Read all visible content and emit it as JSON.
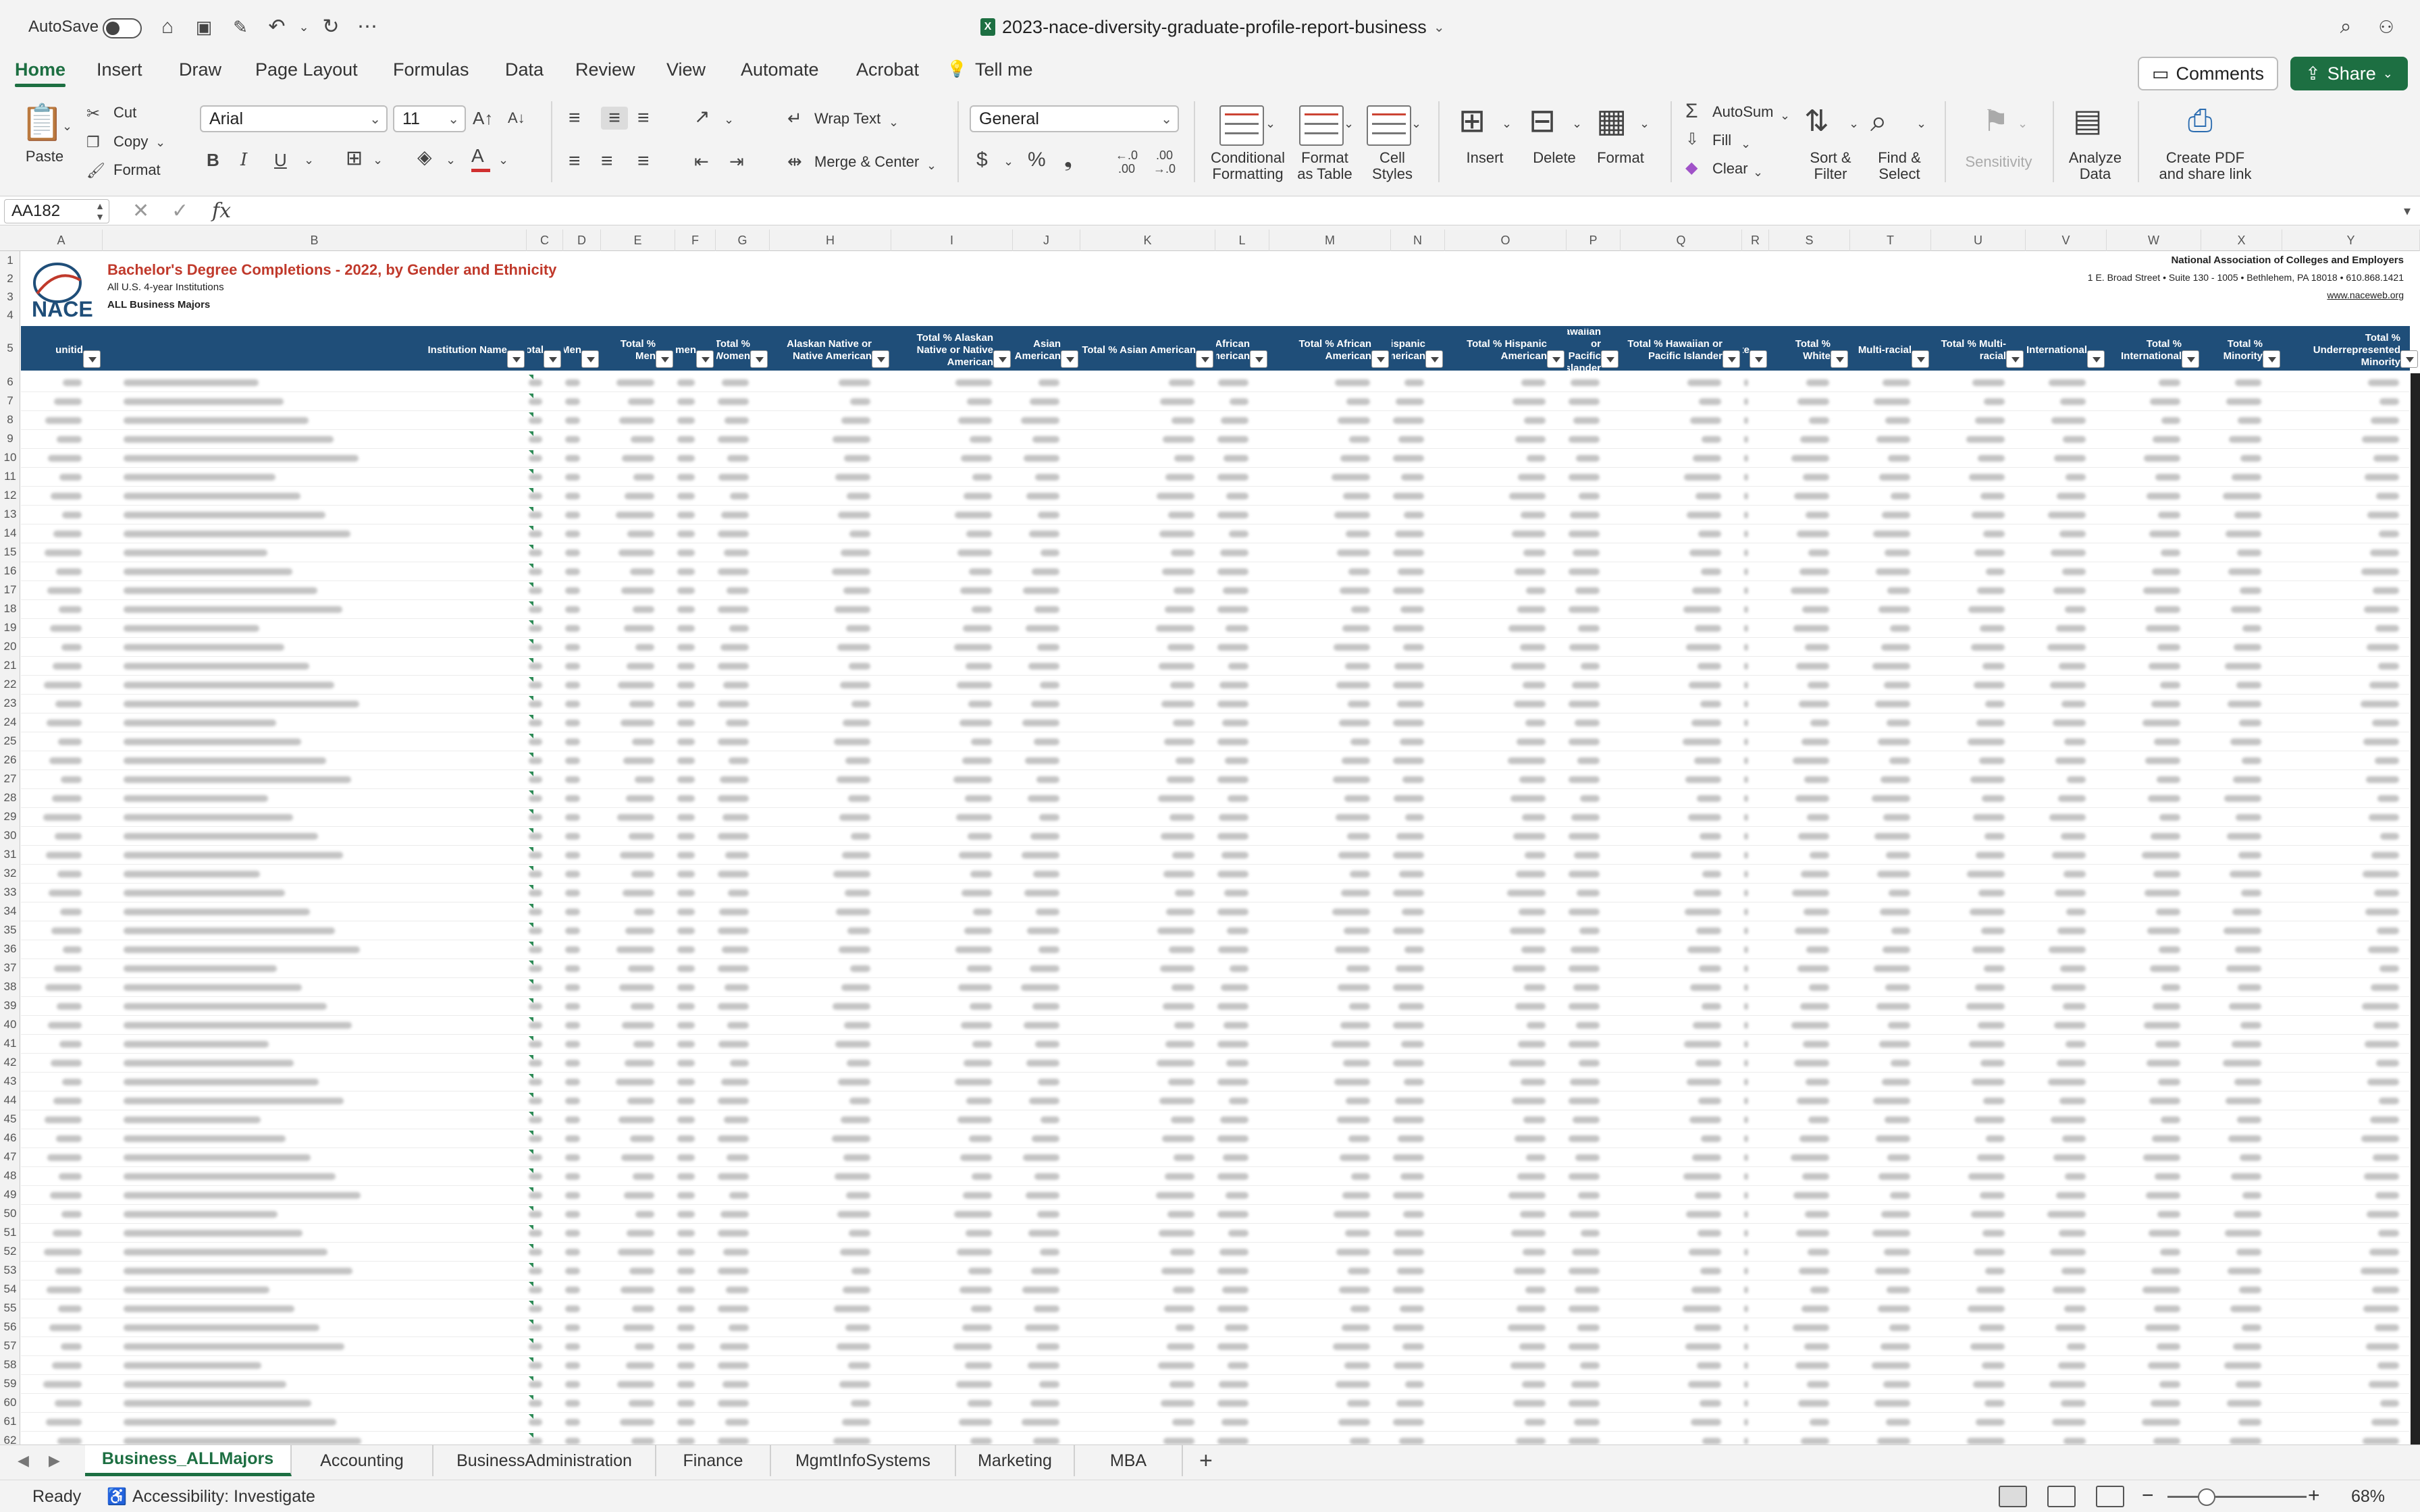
{
  "titlebar": {
    "autosave_label": "AutoSave",
    "document_title": "2023-nace-diversity-graduate-profile-report-business"
  },
  "ribbon_tabs": [
    "Home",
    "Insert",
    "Draw",
    "Page Layout",
    "Formulas",
    "Data",
    "Review",
    "View",
    "Automate",
    "Acrobat",
    "Tell me"
  ],
  "header_buttons": {
    "comments": "Comments",
    "share": "Share"
  },
  "ribbon": {
    "paste": "Paste",
    "cut": "Cut",
    "copy": "Copy",
    "format_painter": "Format",
    "font_name": "Arial",
    "font_size": "11",
    "wrap_text": "Wrap Text",
    "merge_center": "Merge & Center",
    "number_format": "General",
    "conditional_formatting": [
      "Conditional",
      "Formatting"
    ],
    "format_as_table": [
      "Format",
      "as Table"
    ],
    "cell_styles": [
      "Cell",
      "Styles"
    ],
    "insert": "Insert",
    "delete": "Delete",
    "format": "Format",
    "autosum": "AutoSum",
    "fill": "Fill",
    "clear": "Clear",
    "sort_filter": [
      "Sort &",
      "Filter"
    ],
    "find_select": [
      "Find &",
      "Select"
    ],
    "sensitivity": "Sensitivity",
    "analyze_data": [
      "Analyze",
      "Data"
    ],
    "create_pdf": [
      "Create PDF",
      "and share link"
    ]
  },
  "formula_bar": {
    "name_box": "AA182",
    "fx": "fx",
    "formula": ""
  },
  "columns": [
    "A",
    "B",
    "C",
    "D",
    "E",
    "F",
    "G",
    "H",
    "I",
    "J",
    "K",
    "L",
    "M",
    "N",
    "O",
    "P",
    "Q",
    "R",
    "S",
    "T",
    "U",
    "V",
    "W",
    "X",
    "Y"
  ],
  "report": {
    "logo_text": "NACE",
    "title": "Bachelor's Degree Completions - 2022, by Gender and Ethnicity",
    "subtitle": "All U.S. 4-year Institutions",
    "majors": "ALL Business Majors",
    "org_name": "National Association of Colleges and Employers",
    "org_address": "1 E. Broad Street • Suite 130 - 1005 • Bethlehem, PA 18018 • 610.868.1421",
    "org_website": "www.naceweb.org"
  },
  "table_headers": [
    "unitid",
    "Institution Name",
    "Total",
    "Men",
    "Total % Men",
    "Women",
    "Total % Women",
    "Alaskan Native or Native American",
    "Total % Alaskan Native or Native American",
    "Asian American",
    "Total % Asian American",
    "African American",
    "Total % African American",
    "Hispanic American",
    "Total % Hispanic American",
    "Hawaiian or Pacific Islander",
    "Total % Hawaiian or Pacific Islander",
    "White",
    "Total % White",
    "Multi-racial",
    "Total % Multi-racial",
    "International",
    "Total % International",
    "Total % Minority",
    "Total % Underrepresented Minority"
  ],
  "sheet_tabs": [
    "Business_ALLMajors",
    "Accounting",
    "BusinessAdministration",
    "Finance",
    "MgmtInfoSystems",
    "Marketing",
    "MBA"
  ],
  "active_sheet": "Business_ALLMajors",
  "status": {
    "ready": "Ready",
    "accessibility": "Accessibility: Investigate",
    "zoom": "68%",
    "zoom_level_percent": 68
  },
  "colors": {
    "accent": "#1d6f42",
    "header_band": "#1f4e79",
    "title_red": "#c0392b"
  },
  "icons": [
    "home-icon",
    "save-icon",
    "save-as-icon",
    "undo-icon",
    "redo-icon",
    "more-icon",
    "search-icon",
    "share-person-icon"
  ]
}
